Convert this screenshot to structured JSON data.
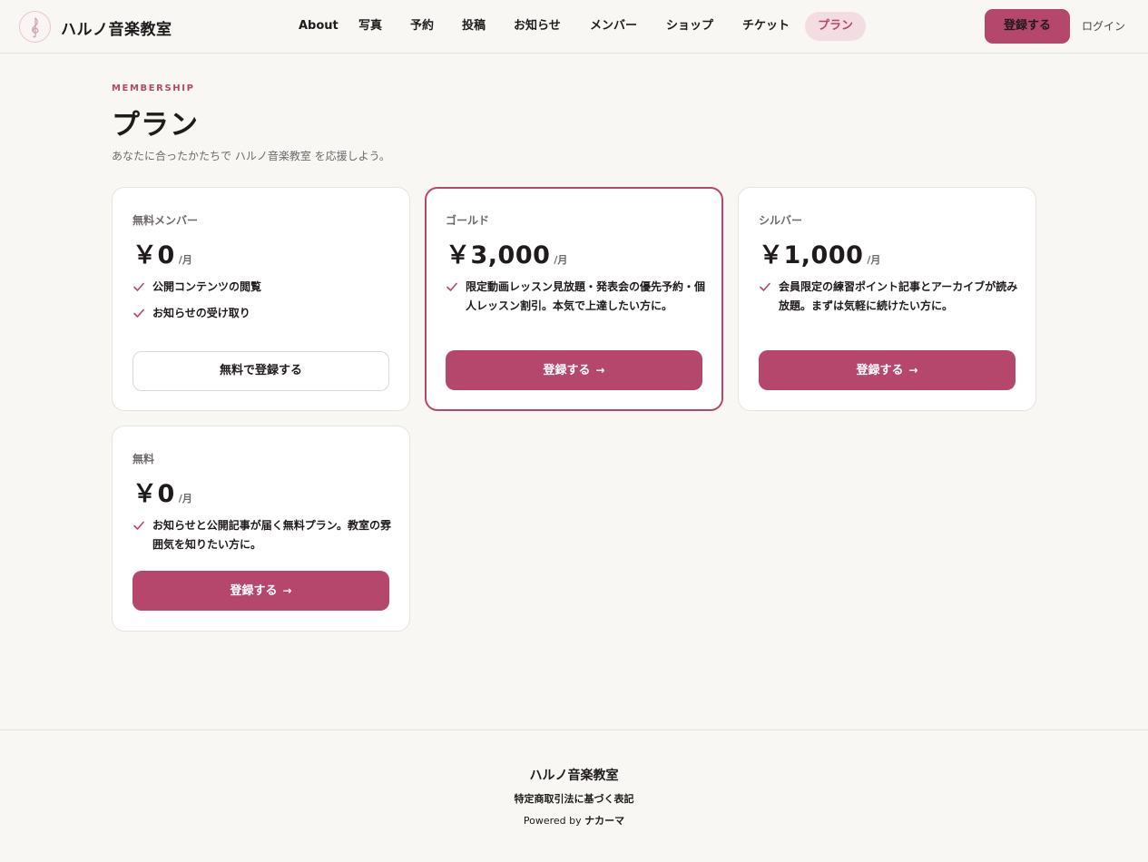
{
  "header": {
    "brand": "ハルノ音楽教室",
    "logo_icon": "treble-clef-icon",
    "nav": [
      {
        "label": "About",
        "active": false
      },
      {
        "label": "写真",
        "active": false
      },
      {
        "label": "予約",
        "active": false
      },
      {
        "label": "投稿",
        "active": false
      },
      {
        "label": "お知らせ",
        "active": false
      },
      {
        "label": "メンバー",
        "active": false
      },
      {
        "label": "ショップ",
        "active": false
      },
      {
        "label": "チケット",
        "active": false
      },
      {
        "label": "プラン",
        "active": true
      }
    ],
    "register_label": "登録する",
    "login_label": "ログイン"
  },
  "hero": {
    "eyebrow": "MEMBERSHIP",
    "title": "プラン",
    "subtitle": "あなたに合ったかたちで ハルノ音楽教室 を応援しよう。"
  },
  "plans": [
    {
      "name": "無料メンバー",
      "price": "￥0",
      "per": "/月",
      "featured": false,
      "features": [
        "公開コンテンツの閲覧",
        "お知らせの受け取り"
      ],
      "button": "無料で登録する",
      "button_style": "outline"
    },
    {
      "name": "ゴールド",
      "price": "￥3,000",
      "per": "/月",
      "featured": true,
      "features": [
        "限定動画レッスン見放題・発表会の優先予約・個人レッスン割引。本気で上達したい方に。"
      ],
      "button": "登録する",
      "button_style": "solid"
    },
    {
      "name": "シルバー",
      "price": "￥1,000",
      "per": "/月",
      "featured": false,
      "features": [
        "会員限定の練習ポイント記事とアーカイブが読み放題。まずは気軽に続けたい方に。"
      ],
      "button": "登録する",
      "button_style": "solid"
    },
    {
      "name": "無料",
      "price": "￥0",
      "per": "/月",
      "featured": false,
      "features": [
        "お知らせと公開記事が届く無料プラン。教室の雰囲気を知りたい方に。"
      ],
      "button": "登録する",
      "button_style": "solid"
    }
  ],
  "footer": {
    "brand": "ハルノ音楽教室",
    "legal": "特定商取引法に基づく表記",
    "powered_prefix": "Powered by",
    "powered_name": "ナカーマ"
  },
  "colors": {
    "accent": "#b5466c",
    "accent_soft": "#f3dde2",
    "background": "#f8f7f4"
  }
}
